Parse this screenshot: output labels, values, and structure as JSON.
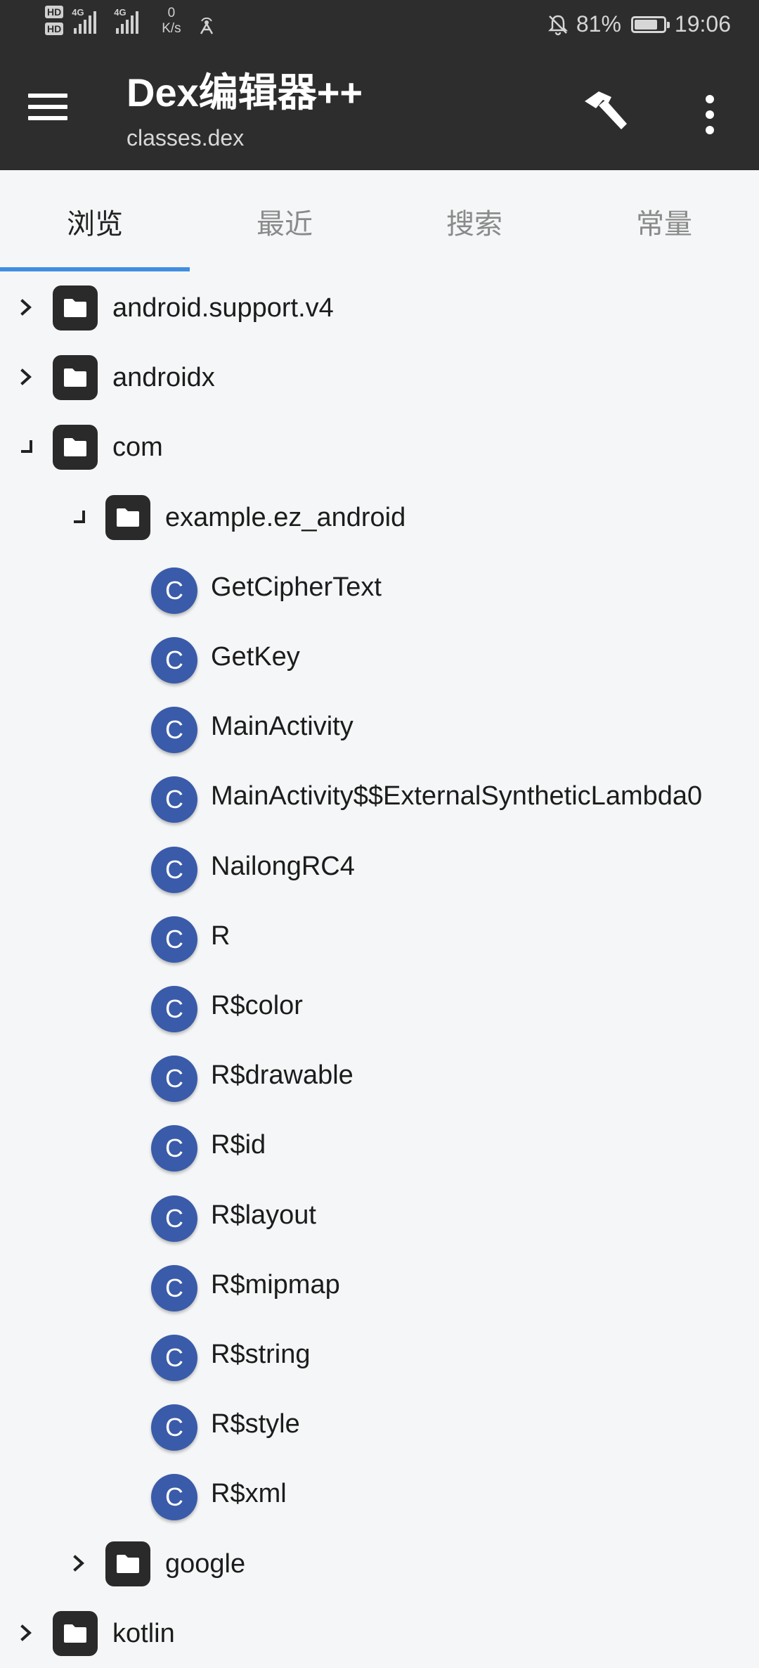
{
  "status_bar": {
    "sim1": "HD",
    "sim2": "HD",
    "net1": "4G",
    "net2": "4G",
    "speed_value": "0",
    "speed_unit": "K/s",
    "battery_percent": "81%",
    "battery_level": 0.81,
    "time": "19:06"
  },
  "app_bar": {
    "title": "Dex编辑器++",
    "subtitle": "classes.dex",
    "icons": [
      "menu-icon",
      "hammer-icon",
      "more-vert-icon"
    ]
  },
  "tabs": {
    "items": [
      "浏览",
      "最近",
      "搜索",
      "常量"
    ],
    "active_index": 0,
    "accent_color": "#3f8ee0"
  },
  "tree": {
    "rows": [
      {
        "type": "package",
        "label": "android.support.v4",
        "state": "collapsed",
        "depth": 0
      },
      {
        "type": "package",
        "label": "androidx",
        "state": "collapsed",
        "depth": 0
      },
      {
        "type": "package",
        "label": "com",
        "state": "expanded",
        "depth": 0
      },
      {
        "type": "package",
        "label": "example.ez_android",
        "state": "expanded",
        "depth": 1
      },
      {
        "type": "class",
        "label": "GetCipherText",
        "depth": 2
      },
      {
        "type": "class",
        "label": "GetKey",
        "depth": 2
      },
      {
        "type": "class",
        "label": "MainActivity",
        "depth": 2
      },
      {
        "type": "class",
        "label": "MainActivity$$ExternalSyntheticLambda0",
        "depth": 2
      },
      {
        "type": "class",
        "label": "NailongRC4",
        "depth": 2
      },
      {
        "type": "class",
        "label": "R",
        "depth": 2
      },
      {
        "type": "class",
        "label": "R$color",
        "depth": 2
      },
      {
        "type": "class",
        "label": "R$drawable",
        "depth": 2
      },
      {
        "type": "class",
        "label": "R$id",
        "depth": 2
      },
      {
        "type": "class",
        "label": "R$layout",
        "depth": 2
      },
      {
        "type": "class",
        "label": "R$mipmap",
        "depth": 2
      },
      {
        "type": "class",
        "label": "R$string",
        "depth": 2
      },
      {
        "type": "class",
        "label": "R$style",
        "depth": 2
      },
      {
        "type": "class",
        "label": "R$xml",
        "depth": 2
      },
      {
        "type": "package",
        "label": "google",
        "state": "collapsed",
        "depth": 1
      },
      {
        "type": "package",
        "label": "kotlin",
        "state": "collapsed",
        "depth": 0
      }
    ],
    "class_icon_letter": "C",
    "class_icon_color": "#3a5ba9",
    "folder_icon_color": "#2a2a2a"
  }
}
